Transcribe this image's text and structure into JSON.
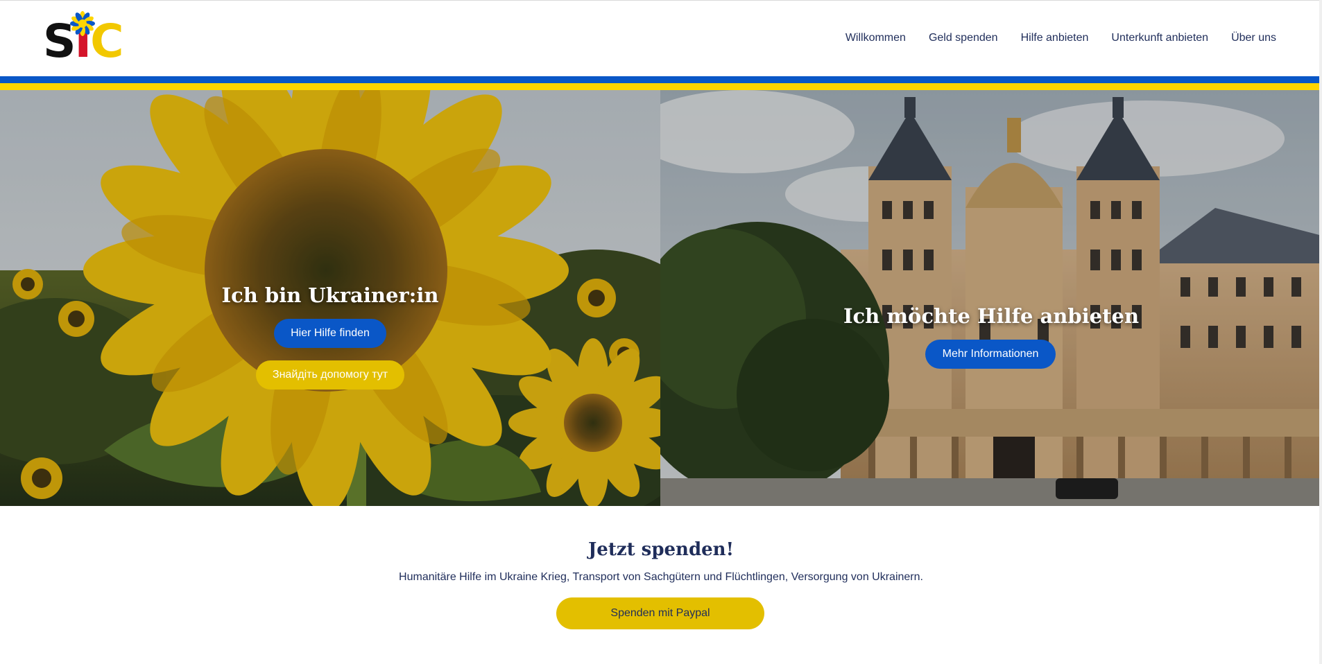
{
  "logo": {
    "letters": [
      "S",
      "I",
      "C"
    ]
  },
  "nav": {
    "items": [
      {
        "label": "Willkommen"
      },
      {
        "label": "Geld spenden"
      },
      {
        "label": "Hilfe anbieten"
      },
      {
        "label": "Unterkunft anbieten"
      },
      {
        "label": "Über uns"
      }
    ]
  },
  "hero_left": {
    "title": "Ich bin Ukrainer:in",
    "primary_button": "Hier Hilfe finden",
    "secondary_button": "Знайдіть допомогу тут",
    "image": "sunflower-photo"
  },
  "hero_right": {
    "title": "Ich möchte Hilfe anbieten",
    "button": "Mehr Informationen",
    "image": "castle-photo"
  },
  "donate": {
    "title": "Jetzt spenden!",
    "text": "Humanitäre Hilfe im Ukraine Krieg, Transport von Sachgütern und Flüchtlingen, Versorgung von Ukrainern.",
    "button": "Spenden mit Paypal"
  },
  "colors": {
    "ukraine_blue": "#0a57c7",
    "ukraine_yellow": "#ffd500",
    "button_yellow": "#e3bf00",
    "text_navy": "#1f2d5a",
    "logo_red": "#d4142a"
  }
}
